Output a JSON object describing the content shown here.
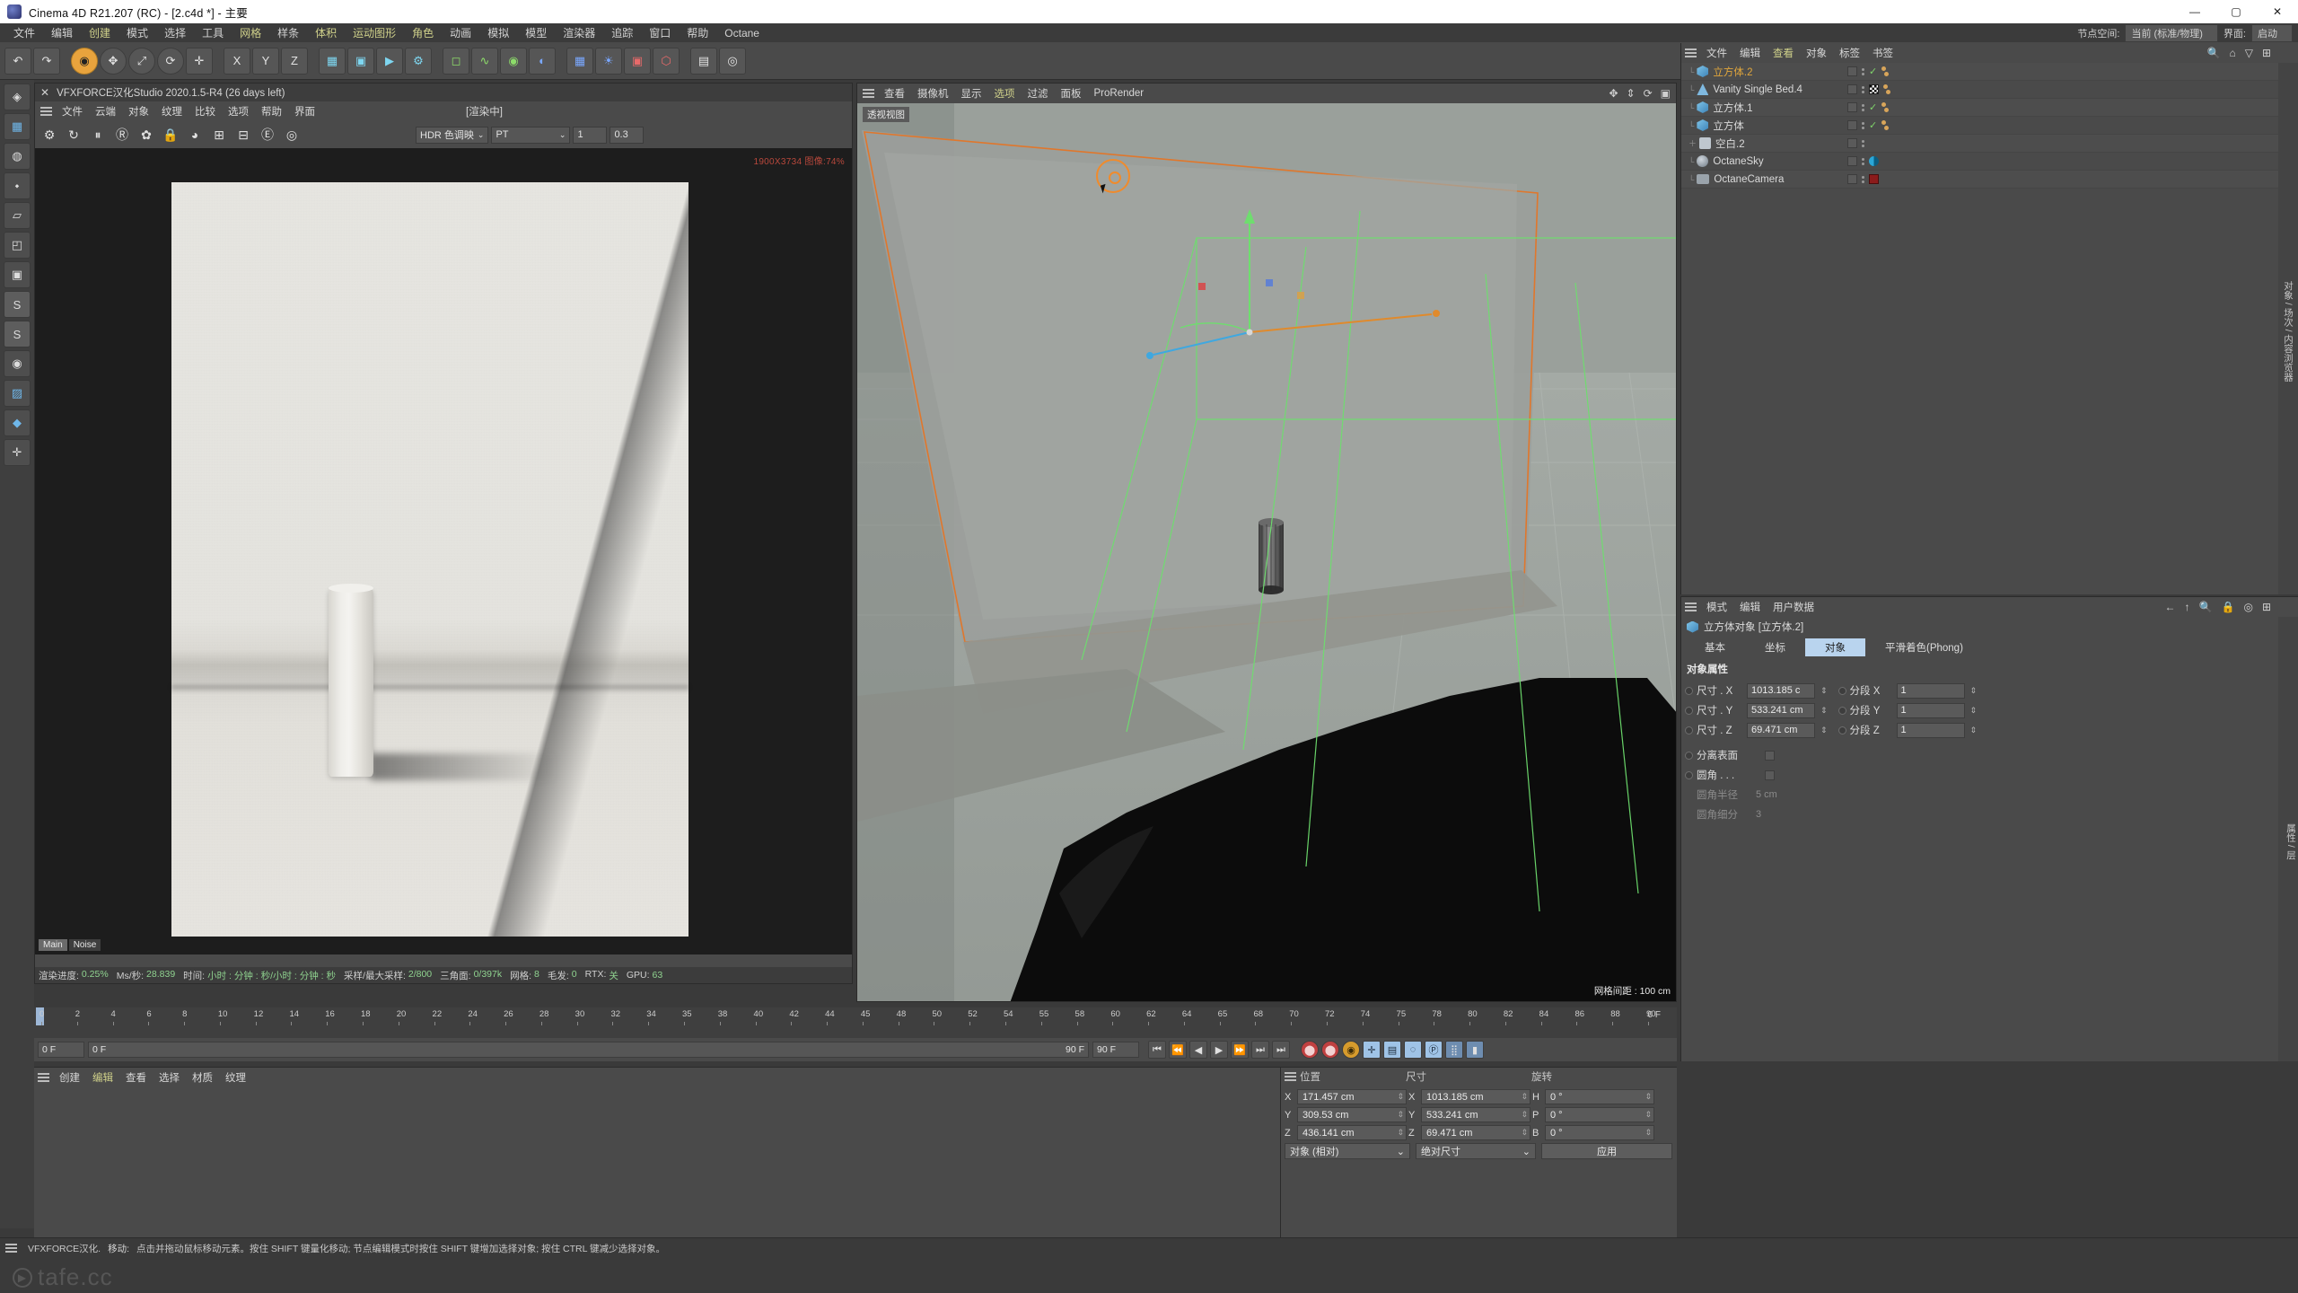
{
  "window": {
    "title": "Cinema 4D R21.207 (RC) - [2.c4d *] - 主要",
    "minimize": "—",
    "maximize": "▢",
    "close": "✕"
  },
  "main_menu": [
    "文件",
    "编辑",
    "创建",
    "模式",
    "选择",
    "工具",
    "网格",
    "样条",
    "体积",
    "运动图形",
    "角色",
    "动画",
    "模拟",
    "模型",
    "渲染器",
    "追踪",
    "窗口",
    "帮助",
    "Octane"
  ],
  "toolbar": {
    "buttons": [
      {
        "name": "undo-button",
        "glyph": "↶"
      },
      {
        "name": "redo-button",
        "glyph": "↷"
      },
      {
        "name": "live-selection-button",
        "glyph": "◉",
        "selected": true
      },
      {
        "name": "move-button",
        "glyph": "✥"
      },
      {
        "name": "scale-button",
        "glyph": "⤢"
      },
      {
        "name": "rotate-button",
        "glyph": "⟳"
      },
      {
        "name": "world-coord-button",
        "glyph": "✛"
      },
      {
        "name": "lock-x-button",
        "glyph": "X"
      },
      {
        "name": "lock-y-button",
        "glyph": "Y"
      },
      {
        "name": "lock-z-button",
        "glyph": "Z"
      },
      {
        "name": "render-view-button",
        "glyph": "▦"
      },
      {
        "name": "render-region-button",
        "glyph": "▣"
      },
      {
        "name": "render-picture-button",
        "glyph": "▶"
      },
      {
        "name": "render-settings-button",
        "glyph": "⚙"
      },
      {
        "name": "cube-primitive-button",
        "glyph": "◻"
      },
      {
        "name": "spline-button",
        "glyph": "∿"
      },
      {
        "name": "generator-button",
        "glyph": "◉"
      },
      {
        "name": "bend-deformer-button",
        "glyph": "◐"
      },
      {
        "name": "scene-button",
        "glyph": "▦"
      },
      {
        "name": "light-button",
        "glyph": "☀"
      },
      {
        "name": "camera-button",
        "glyph": "▣"
      },
      {
        "name": "mograph-button",
        "glyph": "⬡"
      },
      {
        "name": "layout-button",
        "glyph": "▤"
      },
      {
        "name": "help-search-button",
        "glyph": "◎"
      }
    ]
  },
  "left_tools": [
    {
      "name": "make-editable-icon",
      "glyph": "◈"
    },
    {
      "name": "texture-axis-icon",
      "glyph": "▦"
    },
    {
      "name": "viewport-solo-icon",
      "glyph": "◍"
    },
    {
      "name": "points-mode-icon",
      "glyph": "⬩"
    },
    {
      "name": "edges-mode-icon",
      "glyph": "▱"
    },
    {
      "name": "polygons-mode-icon",
      "glyph": "◰"
    },
    {
      "name": "model-mode-icon",
      "glyph": "▣"
    },
    {
      "name": "s-mode-icon",
      "glyph": "S"
    },
    {
      "name": "s2-mode-icon",
      "glyph": "S"
    },
    {
      "name": "axis-mode-icon",
      "glyph": "◉"
    },
    {
      "name": "texture-mode-icon",
      "glyph": "▨"
    },
    {
      "name": "workplane-icon",
      "glyph": "◆"
    },
    {
      "name": "enable-axis-icon",
      "glyph": "✛"
    }
  ],
  "octane_window": {
    "title": "VFXFORCE汉化Studio 2020.1.5-R4 (26 days left)",
    "close_glyph": "✕",
    "menu": [
      "文件",
      "云端",
      "对象",
      "纹理",
      "比较",
      "选项",
      "帮助",
      "界面"
    ],
    "status_tag": "[渲染中]",
    "tools": [
      "⚙",
      "↻",
      "⏸",
      "Ⓡ",
      "✿",
      "🔒",
      "◕",
      "⊞",
      "⊟",
      "Ⓔ",
      "◎"
    ],
    "mode_combo": "HDR 色调映",
    "kernel_combo": "PT",
    "num1": "1",
    "num2": "0.3",
    "resolution_label": "1900X3734 图像:74%",
    "passes": [
      {
        "label": "Main",
        "active": true
      },
      {
        "label": "Noise",
        "active": false
      }
    ],
    "statusbar": [
      {
        "key": "渲染进度:",
        "value": "0.25%"
      },
      {
        "key": "Ms/秒:",
        "value": "28.839"
      },
      {
        "key": "时间:",
        "value": "小时 : 分钟 : 秒/小时 : 分钟 : 秒"
      },
      {
        "key": "采样/最大采样:",
        "value": "2/800"
      },
      {
        "key": "三角面:",
        "value": "0/397k"
      },
      {
        "key": "网格:",
        "value": "8"
      },
      {
        "key": "毛发:",
        "value": "0"
      },
      {
        "key": "RTX:",
        "value": "关"
      },
      {
        "key": "GPU:",
        "value": "63"
      }
    ]
  },
  "viewport": {
    "menu": [
      "查看",
      "摄像机",
      "显示",
      "选项",
      "过滤",
      "面板",
      "ProRender"
    ],
    "highlight_menu": "选项",
    "view_tag": "透视视图",
    "grid_info": "网格间距 : 100 cm",
    "icons": [
      "✥",
      "⇕",
      "⟳",
      "▣"
    ]
  },
  "object_manager": {
    "menu": [
      "文件",
      "编辑",
      "查看",
      "对象",
      "标签",
      "书签"
    ],
    "highlight_menu": "查看",
    "icons": [
      "🔍",
      "⌂",
      "▽",
      "⊞"
    ],
    "side_label": "对象 / 场次 / 内容浏览器",
    "rows": [
      {
        "name": "立方体.2",
        "icon": "cube-icon",
        "selected": true,
        "tag": "check",
        "dots": true
      },
      {
        "name": "Vanity Single Bed.4",
        "icon": "object-icon",
        "selected": false,
        "tag": "checker",
        "dots": true
      },
      {
        "name": "立方体.1",
        "icon": "cube-icon",
        "selected": false,
        "tag": "check",
        "dots": true
      },
      {
        "name": "立方体",
        "icon": "cube-icon",
        "selected": false,
        "tag": "check",
        "dots": true
      },
      {
        "name": "空白.2",
        "icon": "null-icon",
        "selected": false,
        "tag": "none",
        "dots": false
      },
      {
        "name": "OctaneSky",
        "icon": "sky-icon",
        "selected": false,
        "tag": "sky",
        "dots": false
      },
      {
        "name": "OctaneCamera",
        "icon": "camera-icon",
        "selected": false,
        "tag": "camera",
        "dots": false
      }
    ]
  },
  "attribute_manager": {
    "menu": [
      "模式",
      "编辑",
      "用户数据"
    ],
    "icons": [
      "←",
      "↑",
      "🔍",
      "🔒",
      "◎",
      "⊞"
    ],
    "side_label": "属性 / 层",
    "object_title": "立方体对象 [立方体.2]",
    "tabs": [
      {
        "label": "基本",
        "active": false
      },
      {
        "label": "坐标",
        "active": false
      },
      {
        "label": "对象",
        "active": true
      },
      {
        "label": "平滑着色(Phong)",
        "active": false
      }
    ],
    "section_title": "对象属性",
    "fields": [
      {
        "label": "尺寸 . X",
        "value": "1013.185 c",
        "label2": "分段 X",
        "value2": "1"
      },
      {
        "label": "尺寸 . Y",
        "value": "533.241 cm",
        "label2": "分段 Y",
        "value2": "1"
      },
      {
        "label": "尺寸 . Z",
        "value": "69.471 cm",
        "label2": "分段 Z",
        "value2": "1"
      }
    ],
    "checks": [
      {
        "label": "分离表面",
        "checked": false
      },
      {
        "label": "圆角 . . .",
        "checked": false
      }
    ],
    "dimmed": [
      {
        "label": "圆角半径",
        "value": "5 cm"
      },
      {
        "label": "圆角细分",
        "value": "3"
      }
    ]
  },
  "timeline": {
    "ticks": [
      "0",
      "2",
      "4",
      "6",
      "8",
      "10",
      "12",
      "14",
      "16",
      "18",
      "20",
      "22",
      "24",
      "26",
      "28",
      "30",
      "32",
      "34",
      "35",
      "38",
      "40",
      "42",
      "44",
      "45",
      "48",
      "50",
      "52",
      "54",
      "55",
      "58",
      "60",
      "62",
      "64",
      "65",
      "68",
      "70",
      "72",
      "74",
      "75",
      "78",
      "80",
      "82",
      "84",
      "86",
      "88",
      "90"
    ],
    "end_label": "0 F",
    "current_frame": "0 F",
    "range_start": "0 F",
    "range_end": "90 F",
    "preview_end": "90 F",
    "transport": [
      "⏮",
      "⏪",
      "◀",
      "▶",
      "⏩",
      "⏭",
      "⏭"
    ],
    "record_buttons": [
      "⬤",
      "⬤",
      "◉",
      "✛",
      "▤",
      "◌",
      "Ⓟ",
      "⣿",
      "▮"
    ]
  },
  "material_manager": {
    "menu": [
      "创建",
      "编辑",
      "查看",
      "选择",
      "材质",
      "纹理"
    ],
    "highlight_menu": "编辑"
  },
  "coordinates": {
    "headers": [
      "位置",
      "尺寸",
      "旋转"
    ],
    "position": [
      {
        "axis": "X",
        "value": "171.457 cm"
      },
      {
        "axis": "Y",
        "value": "309.53 cm"
      },
      {
        "axis": "Z",
        "value": "436.141 cm"
      }
    ],
    "size": [
      {
        "axis": "X",
        "value": "1013.185 cm"
      },
      {
        "axis": "Y",
        "value": "533.241 cm"
      },
      {
        "axis": "Z",
        "value": "69.471 cm"
      }
    ],
    "rotation": [
      {
        "axis": "H",
        "value": "0 °"
      },
      {
        "axis": "P",
        "value": "0 °"
      },
      {
        "axis": "B",
        "value": "0 °"
      }
    ],
    "mode_select": "对象 (相对)",
    "size_select": "绝对尺寸",
    "apply_label": "应用"
  },
  "status_bar": {
    "prefix": "VFXFORCE汉化.",
    "tool": "移动:",
    "hint": "点击并拖动鼠标移动元素。按住 SHIFT 键量化移动; 节点编辑模式时按住 SHIFT 键增加选择对象; 按住 CTRL 键减少选择对象。",
    "watermark": "tafe.cc"
  },
  "top_right": {
    "layout_label": "节点空间:",
    "layout_value": "当前 (标准/物理)",
    "interface_label": "界面:",
    "interface_value": "启动"
  },
  "colors": {
    "accent_orange": "#e0a63c",
    "menu_highlight": "#cfd08a",
    "tab_active": "#b9d4ee",
    "green_check": "#7fd46a",
    "status_green": "#8fd28f"
  }
}
